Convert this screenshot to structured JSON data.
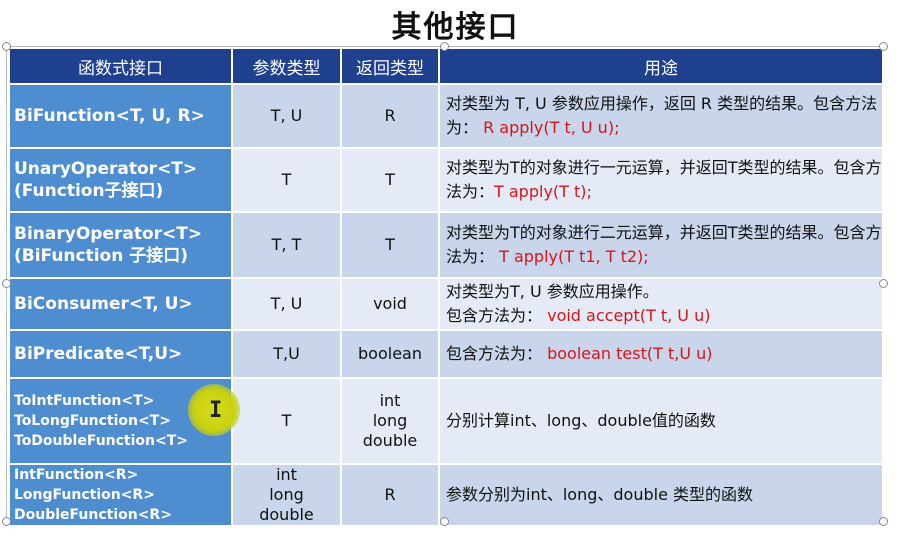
{
  "title": "其他接口",
  "headers": [
    "函数式接口",
    "参数类型",
    "返回类型",
    "用途"
  ],
  "rows": [
    {
      "name_lines": [
        "BiFunction<T, U, R>"
      ],
      "params_lines": [
        "T, U"
      ],
      "return_lines": [
        "R"
      ],
      "desc_text": "对类型为 T, U 参数应用操作，返回 R 类型的结果。包含方法为：",
      "desc_code": " R apply(T t, U u);"
    },
    {
      "name_lines": [
        "UnaryOperator<T>",
        "(Function子接口)"
      ],
      "params_lines": [
        "T"
      ],
      "return_lines": [
        "T"
      ],
      "desc_text": "对类型为T的对象进行一元运算，并返回T类型的结果。包含方法为：",
      "desc_code": "T apply(T t);"
    },
    {
      "name_lines": [
        "BinaryOperator<T>",
        "(BiFunction 子接口)"
      ],
      "params_lines": [
        "T, T"
      ],
      "return_lines": [
        "T"
      ],
      "desc_text": "对类型为T的对象进行二元运算，并返回T类型的结果。包含方法为：",
      "desc_code": "  T apply(T t1, T t2);"
    },
    {
      "name_lines": [
        "BiConsumer<T, U>"
      ],
      "params_lines": [
        "T, U"
      ],
      "return_lines": [
        "void"
      ],
      "desc_text": "对类型为T, U 参数应用操作。",
      "desc_text2": "包含方法为：",
      "desc_code": "  void accept(T t, U u)"
    },
    {
      "name_lines": [
        "BiPredicate<T,U>"
      ],
      "params_lines": [
        "T,U"
      ],
      "return_lines": [
        "boolean"
      ],
      "desc_text": "包含方法为：",
      "desc_code": "  boolean test(T t,U u)"
    },
    {
      "name_lines": [
        "ToIntFunction<T>",
        "ToLongFunction<T>",
        "ToDoubleFunction<T>"
      ],
      "params_lines": [
        "T"
      ],
      "return_lines": [
        "int",
        "long",
        "double"
      ],
      "desc_text": "分别计算int、long、double值的函数",
      "desc_code": ""
    },
    {
      "name_lines": [
        "IntFunction<R>",
        "LongFunction<R>",
        "DoubleFunction<R>"
      ],
      "params_lines": [
        "int",
        "long",
        "double"
      ],
      "return_lines": [
        "R"
      ],
      "desc_text": "参数分别为int、long、double 类型的函数",
      "desc_code": ""
    }
  ]
}
